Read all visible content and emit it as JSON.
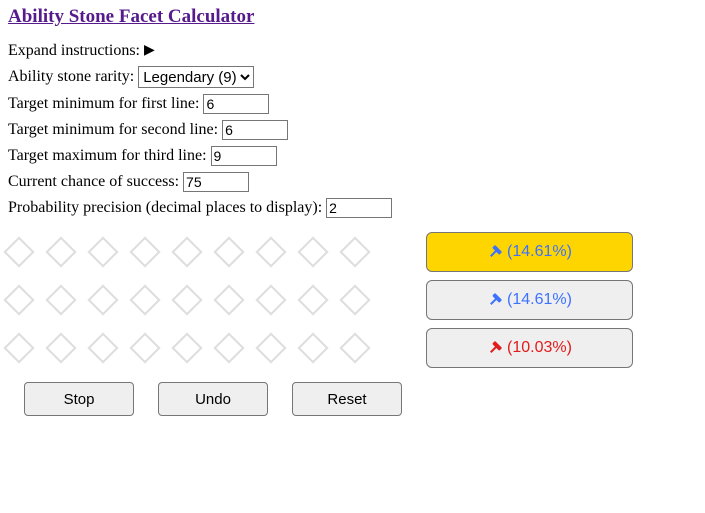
{
  "title": "Ability Stone Facet Calculator",
  "expand_label": "Expand instructions:",
  "rarity_label": "Ability stone rarity:",
  "rarity_value": "Legendary (9)",
  "line1_label": "Target minimum for first line:",
  "line1_value": "6",
  "line2_label": "Target minimum for second line:",
  "line2_value": "6",
  "line3_label": "Target maximum for third line:",
  "line3_value": "9",
  "chance_label": "Current chance of success:",
  "chance_value": "75",
  "precision_label": "Probability precision (decimal places to display):",
  "precision_value": "2",
  "diamond_count": 9,
  "facet_rows": [
    {
      "pct": "(14.61%)",
      "highlight": true,
      "color": "#3d72ff"
    },
    {
      "pct": "(14.61%)",
      "highlight": false,
      "color": "#3d72ff"
    },
    {
      "pct": "(10.03%)",
      "highlight": false,
      "color": "#e21c1c"
    }
  ],
  "buttons": {
    "stop": "Stop",
    "undo": "Undo",
    "reset": "Reset"
  }
}
